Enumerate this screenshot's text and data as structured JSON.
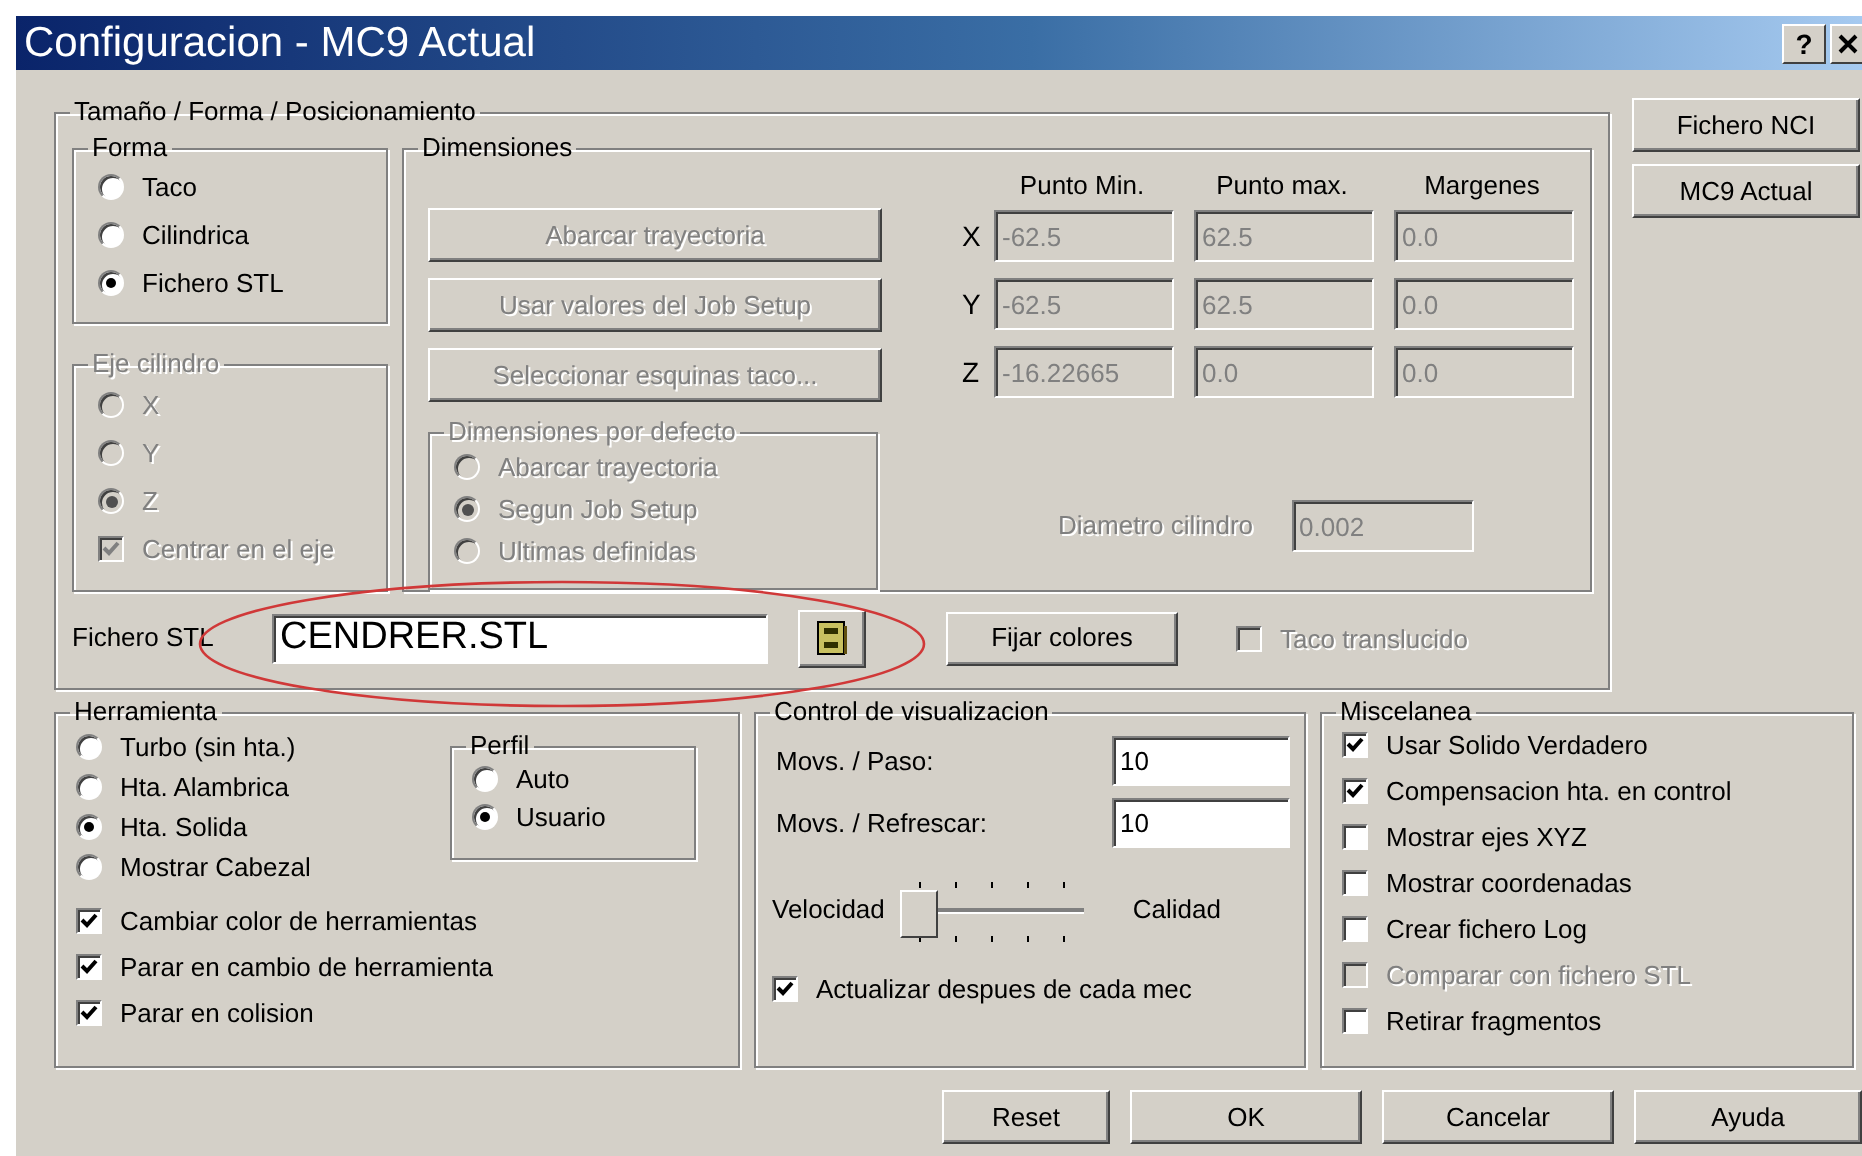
{
  "window": {
    "title": "Configuracion - MC9 Actual",
    "help_button": "?"
  },
  "size_group": {
    "title": "Tamaño / Forma / Posicionamiento",
    "forma": {
      "title": "Forma",
      "options": [
        {
          "label": "Taco",
          "selected": false
        },
        {
          "label": "Cilindrica",
          "selected": false
        },
        {
          "label": "Fichero STL",
          "selected": true
        }
      ]
    },
    "axis": {
      "title": "Eje cilindro",
      "disabled": true,
      "options": [
        {
          "label": "X",
          "selected": false
        },
        {
          "label": "Y",
          "selected": false
        },
        {
          "label": "Z",
          "selected": true
        }
      ],
      "center": {
        "label": "Centrar en el eje",
        "checked": true
      }
    },
    "dimensions": {
      "title": "Dimensiones",
      "buttons": [
        {
          "label": "Abarcar trayectoria",
          "disabled": true
        },
        {
          "label": "Usar valores del Job Setup",
          "disabled": true
        },
        {
          "label": "Seleccionar esquinas taco...",
          "disabled": true
        }
      ],
      "defaults": {
        "title": "Dimensiones por defecto",
        "disabled": true,
        "options": [
          {
            "label": "Abarcar trayectoria",
            "selected": false
          },
          {
            "label": "Segun Job Setup",
            "selected": true
          },
          {
            "label": "Ultimas definidas",
            "selected": false
          }
        ]
      },
      "columns": [
        "Punto Min.",
        "Punto max.",
        "Margenes"
      ],
      "rows": [
        {
          "axis": "X",
          "values": [
            "-62.5",
            "62.5",
            "0.0"
          ]
        },
        {
          "axis": "Y",
          "values": [
            "-62.5",
            "62.5",
            "0.0"
          ]
        },
        {
          "axis": "Z",
          "values": [
            "-16.22665",
            "0.0",
            "0.0"
          ]
        }
      ],
      "diameter": {
        "label": "Diametro cilindro",
        "value": "0.002",
        "disabled": true
      }
    },
    "stl_file": {
      "label": "Fichero STL",
      "value": "CENDRER.STL"
    },
    "colors_button": "Fijar colores",
    "translucent": {
      "label": "Taco translucido",
      "checked": false,
      "disabled": true
    }
  },
  "side_buttons": [
    "Fichero NCI",
    "MC9 Actual"
  ],
  "tool": {
    "title": "Herramienta",
    "options": [
      {
        "label": "Turbo (sin hta.)",
        "selected": false
      },
      {
        "label": "Hta. Alambrica",
        "selected": false
      },
      {
        "label": "Hta. Solida",
        "selected": true
      },
      {
        "label": "Mostrar Cabezal",
        "selected": false
      }
    ],
    "profile": {
      "title": "Perfil",
      "options": [
        {
          "label": "Auto",
          "selected": false
        },
        {
          "label": "Usuario",
          "selected": true
        }
      ]
    },
    "checks": [
      {
        "label": "Cambiar color de herramientas",
        "checked": true
      },
      {
        "label": "Parar en cambio de herramienta",
        "checked": true
      },
      {
        "label": "Parar en colision",
        "checked": true
      }
    ]
  },
  "display": {
    "title": "Control de visualizacion",
    "fields": [
      {
        "label": "Movs. / Paso:",
        "value": "10"
      },
      {
        "label": "Movs. / Refrescar:",
        "value": "10"
      }
    ],
    "slider": {
      "min_label": "Velocidad",
      "max_label": "Calidad",
      "level": 0
    },
    "update": {
      "label": "Actualizar despues de cada mec",
      "checked": true
    }
  },
  "misc": {
    "title": "Miscelanea",
    "checks": [
      {
        "label": "Usar Solido Verdadero",
        "checked": true,
        "disabled": false
      },
      {
        "label": "Compensacion hta. en control",
        "checked": true,
        "disabled": false
      },
      {
        "label": "Mostrar ejes XYZ",
        "checked": false,
        "disabled": false
      },
      {
        "label": "Mostrar coordenadas",
        "checked": false,
        "disabled": false
      },
      {
        "label": "Crear fichero Log",
        "checked": false,
        "disabled": false
      },
      {
        "label": "Comparar con fichero STL",
        "checked": false,
        "disabled": true
      },
      {
        "label": "Retirar fragmentos",
        "checked": false,
        "disabled": false
      }
    ]
  },
  "buttons": [
    "Reset",
    "OK",
    "Cancelar",
    "Ayuda"
  ],
  "annotation": {
    "kind": "ellipse"
  }
}
